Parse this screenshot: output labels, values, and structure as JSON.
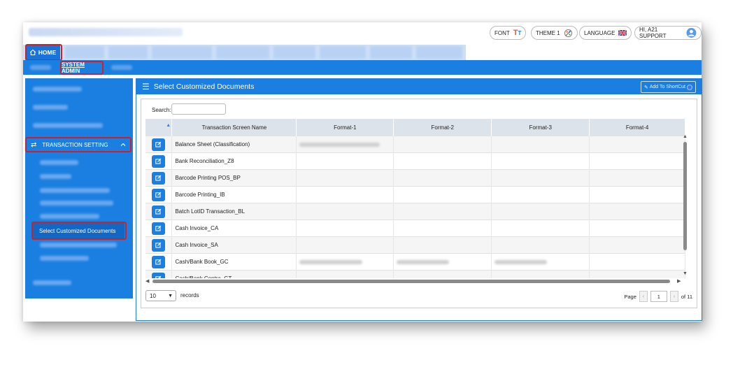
{
  "header": {
    "font_label": "FONT",
    "theme_label": "THEME 1",
    "language_label": "LANGUAGE",
    "user_label": "HI, A21 SUPPORT"
  },
  "nav": {
    "home_label": "HOME",
    "system_admin_label": "SYSTEM ADMIN"
  },
  "sidebar": {
    "transaction_setting_label": "TRANSACTION SETTING",
    "selected_item_label": "Select Customized Documents"
  },
  "panel": {
    "title": "Select Customized Documents",
    "shortcut_label": "Add To ShortCut"
  },
  "search": {
    "label": "Search:",
    "value": ""
  },
  "table": {
    "columns": [
      "Transaction Screen Name",
      "Format-1",
      "Format-2",
      "Format-3",
      "Format-4"
    ],
    "rows": [
      "Balance Sheet (Classification)",
      "Bank Reconciliation_Z8",
      "Barcode Printing POS_BP",
      "Barcode Printing_IB",
      "Batch LotID Transaction_BL",
      "Cash Invoice_CA",
      "Cash Invoice_SA",
      "Cash/Bank Book_GC",
      "Cash/Bank Contra_GT"
    ]
  },
  "pager": {
    "page_size": "10",
    "records_label": "records",
    "page_label": "Page",
    "current_page": "1",
    "of_label": "of 11"
  },
  "colors": {
    "primary": "#1a7fe0",
    "highlight": "#c8232c"
  }
}
